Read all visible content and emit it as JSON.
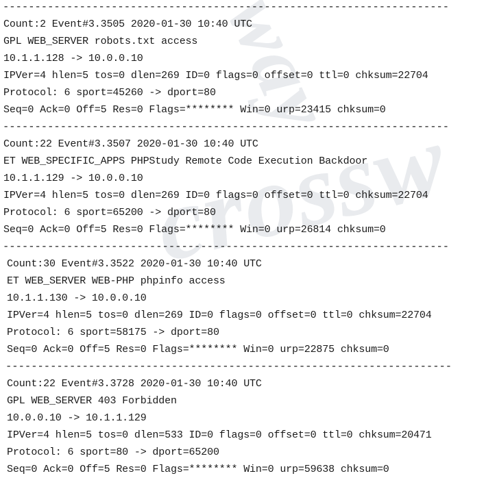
{
  "watermark": {
    "part_a": "way",
    "part_b": "crossw"
  },
  "separator": "----------------------------------------------------------------------",
  "log": {
    "blocks": [
      {
        "indent": "a",
        "lines": [
          "Count:2 Event#3.3505 2020-01-30 10:40 UTC",
          "GPL WEB_SERVER robots.txt access",
          "10.1.1.128 -> 10.0.0.10",
          "IPVer=4 hlen=5 tos=0 dlen=269 ID=0 flags=0 offset=0 ttl=0 chksum=22704",
          "Protocol: 6 sport=45260 -> dport=80",
          "Seq=0 Ack=0 Off=5 Res=0 Flags=******** Win=0 urp=23415 chksum=0"
        ],
        "fields": {
          "count": "2",
          "event": "3.3505",
          "date": "2020-01-30",
          "time": "10:40",
          "timezone": "UTC",
          "rule": "GPL WEB_SERVER robots.txt access",
          "src_ip": "10.1.1.128",
          "dst_ip": "10.0.0.10",
          "ipver": "4",
          "hlen": "5",
          "tos": "0",
          "dlen": "269",
          "id": "0",
          "flags": "0",
          "offset": "0",
          "ttl": "0",
          "ip_chksum": "22704",
          "protocol": "6",
          "sport": "45260",
          "dport": "80",
          "seq": "0",
          "ack": "0",
          "off": "5",
          "res": "0",
          "tcp_flags": "********",
          "win": "0",
          "urp": "23415",
          "tcp_chksum": "0"
        }
      },
      {
        "indent": "a",
        "lines": [
          "Count:22 Event#3.3507 2020-01-30 10:40 UTC",
          "ET WEB_SPECIFIC_APPS PHPStudy Remote Code Execution Backdoor",
          "10.1.1.129 -> 10.0.0.10",
          "IPVer=4 hlen=5 tos=0 dlen=269 ID=0 flags=0 offset=0 ttl=0 chksum=22704",
          "Protocol: 6 sport=65200 -> dport=80",
          "Seq=0 Ack=0 Off=5 Res=0 Flags=******** Win=0 urp=26814 chksum=0"
        ],
        "fields": {
          "count": "22",
          "event": "3.3507",
          "date": "2020-01-30",
          "time": "10:40",
          "timezone": "UTC",
          "rule": "ET WEB_SPECIFIC_APPS PHPStudy Remote Code Execution Backdoor",
          "src_ip": "10.1.1.129",
          "dst_ip": "10.0.0.10",
          "ipver": "4",
          "hlen": "5",
          "tos": "0",
          "dlen": "269",
          "id": "0",
          "flags": "0",
          "offset": "0",
          "ttl": "0",
          "ip_chksum": "22704",
          "protocol": "6",
          "sport": "65200",
          "dport": "80",
          "seq": "0",
          "ack": "0",
          "off": "5",
          "res": "0",
          "tcp_flags": "********",
          "win": "0",
          "urp": "26814",
          "tcp_chksum": "0"
        }
      },
      {
        "indent": "b",
        "lines": [
          "Count:30 Event#3.3522 2020-01-30 10:40 UTC",
          "ET WEB_SERVER WEB-PHP phpinfo access",
          "10.1.1.130 -> 10.0.0.10",
          "IPVer=4 hlen=5 tos=0 dlen=269 ID=0 flags=0 offset=0 ttl=0 chksum=22704",
          "Protocol: 6 sport=58175 -> dport=80",
          "Seq=0 Ack=0 Off=5 Res=0 Flags=******** Win=0 urp=22875 chksum=0"
        ],
        "fields": {
          "count": "30",
          "event": "3.3522",
          "date": "2020-01-30",
          "time": "10:40",
          "timezone": "UTC",
          "rule": "ET WEB_SERVER WEB-PHP phpinfo access",
          "src_ip": "10.1.1.130",
          "dst_ip": "10.0.0.10",
          "ipver": "4",
          "hlen": "5",
          "tos": "0",
          "dlen": "269",
          "id": "0",
          "flags": "0",
          "offset": "0",
          "ttl": "0",
          "ip_chksum": "22704",
          "protocol": "6",
          "sport": "58175",
          "dport": "80",
          "seq": "0",
          "ack": "0",
          "off": "5",
          "res": "0",
          "tcp_flags": "********",
          "win": "0",
          "urp": "22875",
          "tcp_chksum": "0"
        }
      },
      {
        "indent": "b",
        "lines": [
          "Count:22 Event#3.3728 2020-01-30 10:40 UTC",
          "GPL WEB_SERVER 403 Forbidden",
          "10.0.0.10 -> 10.1.1.129",
          "IPVer=4 hlen=5 tos=0 dlen=533 ID=0 flags=0 offset=0 ttl=0 chksum=20471",
          "Protocol: 6 sport=80 -> dport=65200",
          "Seq=0 Ack=0 Off=5 Res=0 Flags=******** Win=0 urp=59638 chksum=0"
        ],
        "fields": {
          "count": "22",
          "event": "3.3728",
          "date": "2020-01-30",
          "time": "10:40",
          "timezone": "UTC",
          "rule": "GPL WEB_SERVER 403 Forbidden",
          "src_ip": "10.0.0.10",
          "dst_ip": "10.1.1.129",
          "ipver": "4",
          "hlen": "5",
          "tos": "0",
          "dlen": "533",
          "id": "0",
          "flags": "0",
          "offset": "0",
          "ttl": "0",
          "ip_chksum": "20471",
          "protocol": "6",
          "sport": "80",
          "dport": "65200",
          "seq": "0",
          "ack": "0",
          "off": "5",
          "res": "0",
          "tcp_flags": "********",
          "win": "0",
          "urp": "59638",
          "tcp_chksum": "0"
        }
      }
    ]
  }
}
